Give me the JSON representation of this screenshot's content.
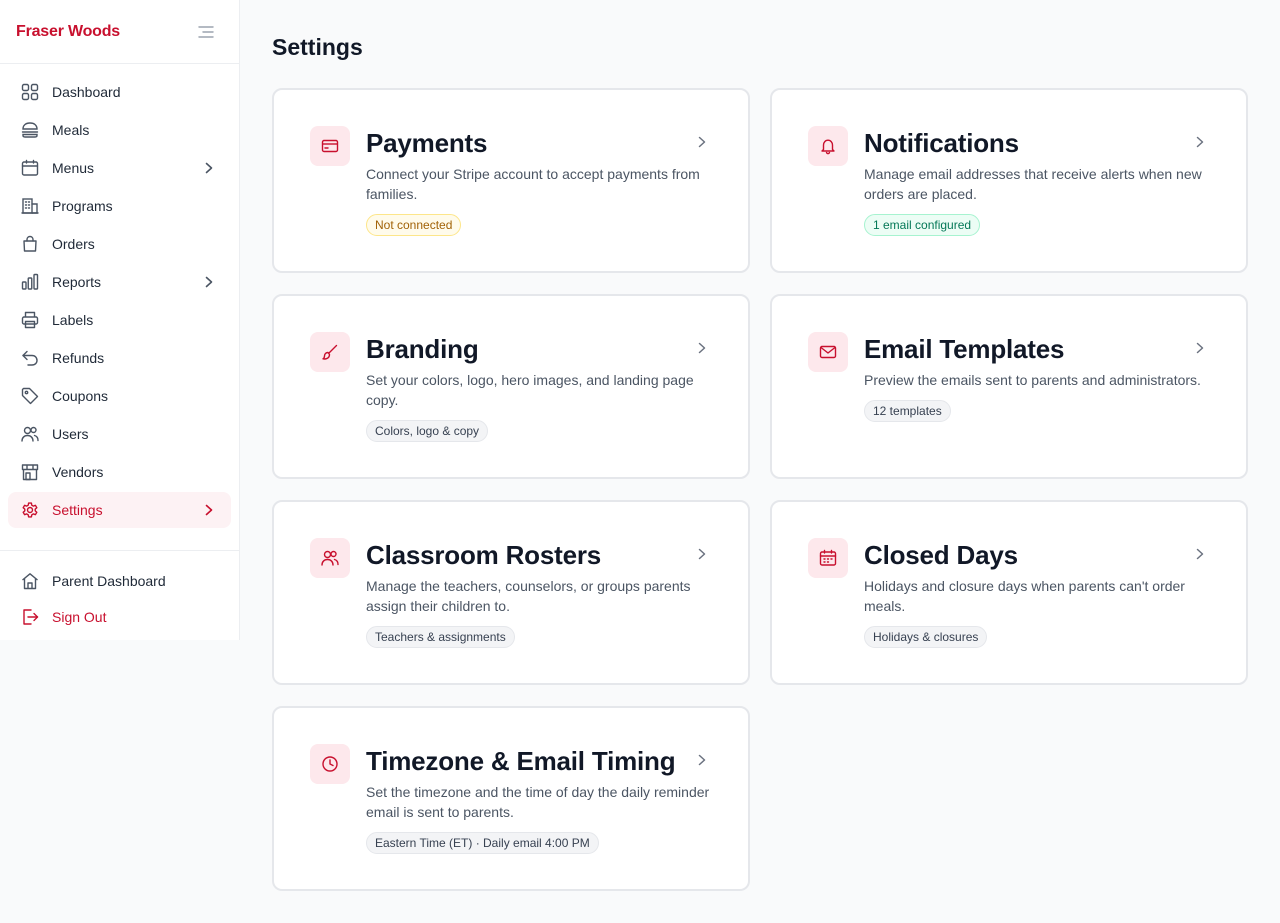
{
  "app": {
    "brand": "Fraser Woods"
  },
  "nav": {
    "items": [
      {
        "label": "Dashboard",
        "icon": "grid-icon"
      },
      {
        "label": "Meals",
        "icon": "burger-icon"
      },
      {
        "label": "Menus",
        "icon": "calendar-icon",
        "expandable": true
      },
      {
        "label": "Programs",
        "icon": "building-icon"
      },
      {
        "label": "Orders",
        "icon": "shopping-bag-icon"
      },
      {
        "label": "Reports",
        "icon": "bar-chart-icon",
        "expandable": true
      },
      {
        "label": "Labels",
        "icon": "printer-icon"
      },
      {
        "label": "Refunds",
        "icon": "undo-icon"
      },
      {
        "label": "Coupons",
        "icon": "tag-icon"
      },
      {
        "label": "Users",
        "icon": "users-icon"
      },
      {
        "label": "Vendors",
        "icon": "store-icon"
      },
      {
        "label": "Settings",
        "icon": "gear-icon",
        "expandable": true,
        "active": true
      }
    ],
    "bottom": [
      {
        "label": "Parent Dashboard",
        "icon": "home-icon"
      },
      {
        "label": "Sign Out",
        "icon": "sign-out-icon"
      }
    ]
  },
  "page": {
    "title": "Settings"
  },
  "cards": [
    {
      "title": "Payments",
      "description": "Connect your Stripe account to accept payments from families.",
      "badge": "Not connected",
      "badge_status": "warning",
      "icon": "credit-card-icon"
    },
    {
      "title": "Notifications",
      "description": "Manage email addresses that receive alerts when new orders are placed.",
      "badge": "1 email configured",
      "badge_status": "success",
      "icon": "bell-icon"
    },
    {
      "title": "Branding",
      "description": "Set your colors, logo, hero images, and landing page copy.",
      "badge": "Colors, logo & copy",
      "badge_status": "neutral",
      "icon": "paintbrush-icon"
    },
    {
      "title": "Email Templates",
      "description": "Preview the emails sent to parents and administrators.",
      "badge": "12 templates",
      "badge_status": "neutral",
      "icon": "mail-icon"
    },
    {
      "title": "Classroom Rosters",
      "description": "Manage the teachers, counselors, or groups parents assign their children to.",
      "badge": "Teachers & assignments",
      "badge_status": "neutral",
      "icon": "users-icon"
    },
    {
      "title": "Closed Days",
      "description": "Holidays and closure days when parents can't order meals.",
      "badge": "Holidays & closures",
      "badge_status": "neutral",
      "icon": "calendar-icon"
    },
    {
      "title": "Timezone & Email Timing",
      "description": "Set the timezone and the time of day the daily reminder email is sent to parents.",
      "badge": "Eastern Time (ET) · Daily email 4:00 PM",
      "badge_status": "neutral",
      "icon": "clock-icon"
    }
  ],
  "colors": {
    "accent": "#c8102e",
    "accent_bg": "#fde8ec",
    "warning_badge": "#a16207",
    "success_badge": "#047857"
  }
}
